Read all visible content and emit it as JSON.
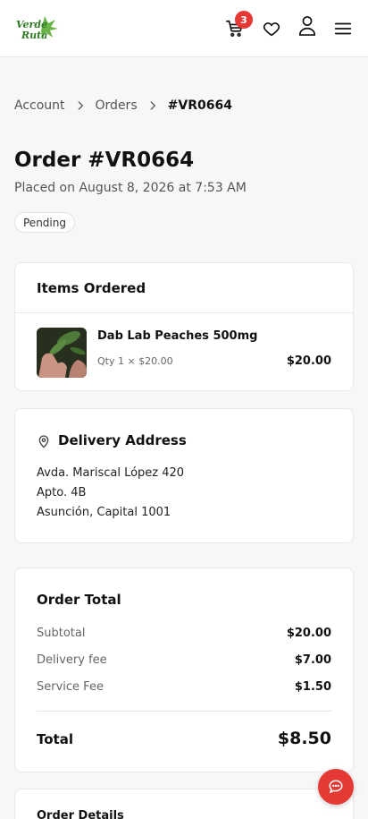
{
  "brand": {
    "logo_line1": "Verde",
    "logo_line2": "Ruta",
    "accent": "#e53935",
    "logo_green": "#3a8f2c"
  },
  "header": {
    "cart_count": "3",
    "icons": [
      "cart-icon",
      "heart-icon",
      "user-icon",
      "menu-icon"
    ]
  },
  "breadcrumb": {
    "account": "Account",
    "orders": "Orders",
    "current": "#VR0664"
  },
  "order": {
    "title": "Order #VR0664",
    "placed": "Placed on August 8, 2026 at 7:53 AM",
    "status": "Pending"
  },
  "items_card": {
    "heading": "Items Ordered",
    "items": [
      {
        "name": "Dab Lab Peaches 500mg",
        "qty": "Qty 1 × $20.00",
        "price": "$20.00"
      }
    ]
  },
  "address_card": {
    "heading": "Delivery Address",
    "lines": [
      "Avda. Mariscal López 420",
      "Apto. 4B",
      "Asunción, Capital 1001"
    ]
  },
  "totals_card": {
    "heading": "Order Total",
    "rows": [
      {
        "label": "Subtotal",
        "value": "$20.00"
      },
      {
        "label": "Delivery fee",
        "value": "$7.00"
      },
      {
        "label": "Service Fee",
        "value": "$1.50"
      }
    ],
    "total_label": "Total",
    "total_value": "$8.50"
  },
  "details_card": {
    "heading": "Order Details"
  }
}
